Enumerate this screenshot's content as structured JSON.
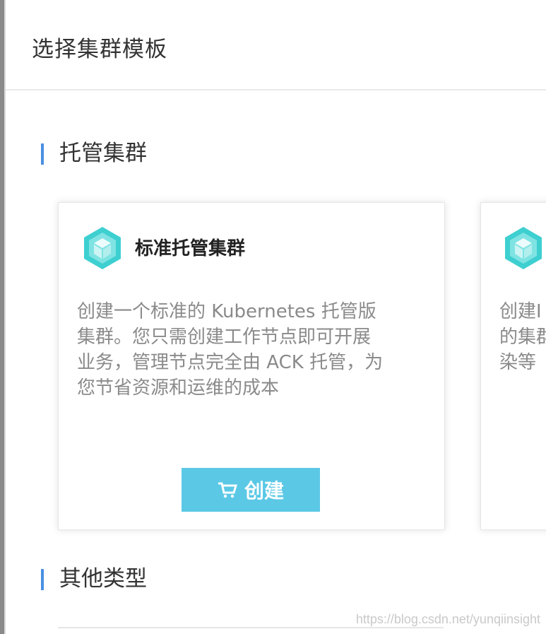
{
  "page": {
    "title": "选择集群模板"
  },
  "sections": [
    {
      "title": "托管集群"
    },
    {
      "title": "其他类型"
    }
  ],
  "cards": [
    {
      "title": "标准托管集群",
      "description": "创建一个标准的 Kubernetes 托管版\n集群。您只需创建工作节点即可开展\n业务，管理节点完全由 ACK 托管，为\n您节省资源和运维的成本",
      "button_label": "创建",
      "icon": "cube-icon"
    },
    {
      "title": "",
      "description": "创建I\n的集群\n染等",
      "icon": "cube-icon"
    }
  ],
  "watermark": "https://blog.csdn.net/yunqiinsight",
  "colors": {
    "accent": "#4a90e2",
    "button": "#5bc8e6",
    "icon": "#3ecfd0"
  }
}
